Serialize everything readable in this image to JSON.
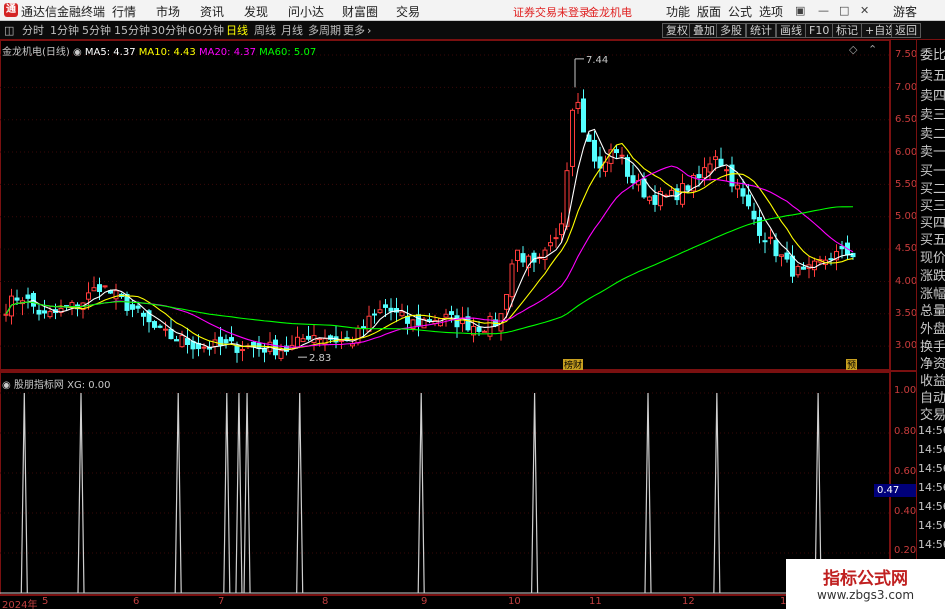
{
  "window": {
    "app_title": "通达信金融终端",
    "menu": [
      "行情",
      "市场",
      "资讯",
      "发现",
      "问小达",
      "财富圈",
      "交易"
    ],
    "login_status": "证券交易未登录",
    "stock_name": "金龙机电",
    "right_menu": [
      "功能",
      "版面",
      "公式",
      "选项"
    ],
    "user": "游客"
  },
  "toolbar": {
    "periods": [
      "分时",
      "1分钟",
      "5分钟",
      "15分钟",
      "30分钟",
      "60分钟",
      "日线",
      "周线",
      "月线",
      "多周期",
      "更多"
    ],
    "active_period": "日线",
    "right_buttons": [
      "复权",
      "叠加",
      "多股",
      "统计",
      "画线",
      "F10",
      "标记",
      "+自选",
      "返回"
    ]
  },
  "main_chart": {
    "stock_label": "金龙机电(日线)",
    "ma": [
      {
        "label": "MA5: 4.37",
        "color": "#ffffff"
      },
      {
        "label": "MA10: 4.43",
        "color": "#ffff00"
      },
      {
        "label": "MA20: 4.37",
        "color": "#ff00ff"
      },
      {
        "label": "MA60: 5.07",
        "color": "#00ff00"
      }
    ],
    "high_label": "7.44",
    "low_label": "2.83",
    "tag_1": "榜财",
    "tag_2": "预"
  },
  "indicator": {
    "name": "股朋指标网",
    "value_label": "XG: 0.00",
    "current": "0.47"
  },
  "chart_data": [
    {
      "type": "candlestick",
      "title": "金龙机电(日线)",
      "y_ticks": [
        "7.50",
        "7.00",
        "6.50",
        "6.00",
        "5.50",
        "5.00",
        "4.50",
        "4.00",
        "3.50",
        "3.00"
      ],
      "ylim": [
        2.6,
        7.65
      ],
      "series": [
        {
          "name": "MA5",
          "value": "4.37",
          "color": "#ffffff"
        },
        {
          "name": "MA10",
          "value": "4.43",
          "color": "#ffff00"
        },
        {
          "name": "MA20",
          "value": "4.37",
          "color": "#ff00ff"
        },
        {
          "name": "MA60",
          "value": "5.07",
          "color": "#00ff00"
        }
      ],
      "annotations": {
        "max": "7.44",
        "min": "2.83"
      },
      "x_ticks": [
        "2024年",
        "5",
        "6",
        "7",
        "8",
        "9",
        "10",
        "11",
        "12",
        "1"
      ]
    },
    {
      "type": "line",
      "title": "股朋指标网",
      "y_ticks": [
        "1.00",
        "0.80",
        "0.60",
        "0.40",
        "0.20"
      ],
      "ylim": [
        0,
        1
      ],
      "signal_x": [
        3,
        10,
        22,
        28,
        29.5,
        30.5,
        37,
        52,
        66,
        80,
        88.5,
        101
      ],
      "value": "0.00"
    }
  ],
  "axes": {
    "x_ticks": [
      "2024年",
      "5",
      "6",
      "7",
      "8",
      "9",
      "10",
      "11",
      "12",
      "1"
    ],
    "price_ticks": [
      "7.50",
      "7.00",
      "6.50",
      "6.00",
      "5.50",
      "5.00",
      "4.50",
      "4.00",
      "3.50",
      "3.00"
    ],
    "ind_ticks": [
      "1.00",
      "0.80",
      "0.60",
      "0.40",
      "0.20"
    ]
  },
  "quote_panel": {
    "items": [
      "委比",
      "卖五",
      "卖四",
      "卖三",
      "卖二",
      "卖一",
      "买一",
      "买二",
      "买三",
      "买四",
      "买五",
      "现价",
      "涨跌",
      "涨幅",
      "总量",
      "外盘",
      "换手",
      "净资",
      "收益"
    ],
    "trade_label_1": "自动",
    "trade_label_2": "交易",
    "times": [
      "14:56",
      "14:56",
      "14:56",
      "14:56",
      "14:56",
      "14:56",
      "14:56",
      "14:56",
      "14:56"
    ]
  },
  "watermark": {
    "title": "指标公式网",
    "url": "www.zbgs3.com"
  },
  "colors": {
    "up": "#ff3c3c",
    "down": "#54ffff",
    "ma5": "#ffffff",
    "ma10": "#ffff00",
    "ma20": "#ff00ff",
    "ma60": "#00ff00",
    "frame": "#7a1010"
  }
}
